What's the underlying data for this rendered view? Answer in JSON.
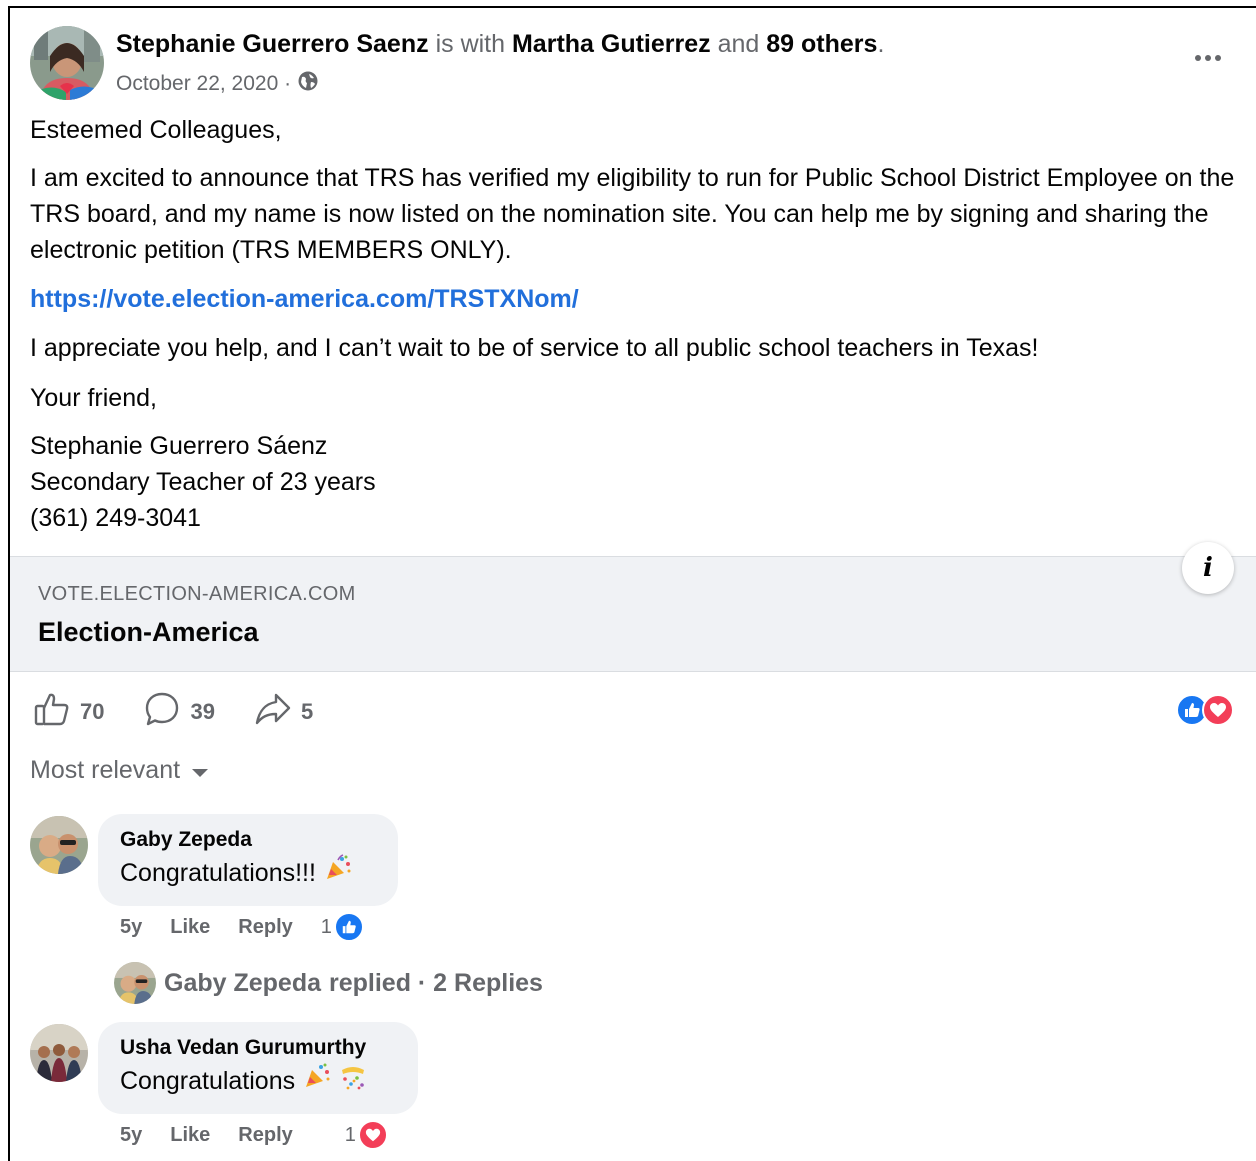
{
  "post": {
    "author": "Stephanie Guerrero Saenz",
    "with_text": "is with",
    "tagged": "Martha Gutierrez",
    "and_text": "and",
    "others": "89 others",
    "period": ".",
    "date": "October 22, 2020 ·",
    "audience_icon": "globe-icon",
    "more_icon": "more-options-icon"
  },
  "body": {
    "greeting": "Esteemed Colleagues,",
    "paragraph": "I am excited to announce that TRS has verified my eligibility to run for Public School District Employee on the TRS board, and my name is now listed on the nomination site. You can help me by signing and sharing the electronic petition (TRS MEMBERS ONLY).",
    "link": "https://vote.election-america.com/TRSTXNom/",
    "appreciation": "I appreciate you help, and I can’t wait to be of service to all public school teachers in Texas!",
    "closing": "Your friend,",
    "signature_name": "Stephanie Guerrero Sáenz",
    "signature_title": "Secondary Teacher of 23 years",
    "signature_phone": "(361) 249-3041"
  },
  "preview": {
    "domain": "VOTE.ELECTION-AMERICA.COM",
    "title": "Election-America",
    "info_icon": "info-icon"
  },
  "actions": {
    "likes": "70",
    "comments": "39",
    "shares": "5"
  },
  "reactions": [
    "like",
    "love"
  ],
  "colors": {
    "link": "#216fdb",
    "like_blue": "#1877f2",
    "love_red": "#f33e58",
    "muted": "#65676b",
    "bubble": "#f0f2f5"
  },
  "sort_label": "Most relevant",
  "comments": [
    {
      "name": "Gaby Zepeda",
      "text": "Congratulations!!!",
      "emoji": "🎉",
      "age": "5y",
      "like_label": "Like",
      "reply_label": "Reply",
      "reaction_count": "1",
      "reaction": "like"
    },
    {
      "name": "Usha Vedan Gurumurthy",
      "text": "Congratulations",
      "emoji": "🎉🎊",
      "age": "5y",
      "like_label": "Like",
      "reply_label": "Reply",
      "reaction_count": "1",
      "reaction": "love"
    }
  ],
  "replies_summary": {
    "name": "Gaby Zepeda",
    "text": "replied · 2 Replies"
  }
}
